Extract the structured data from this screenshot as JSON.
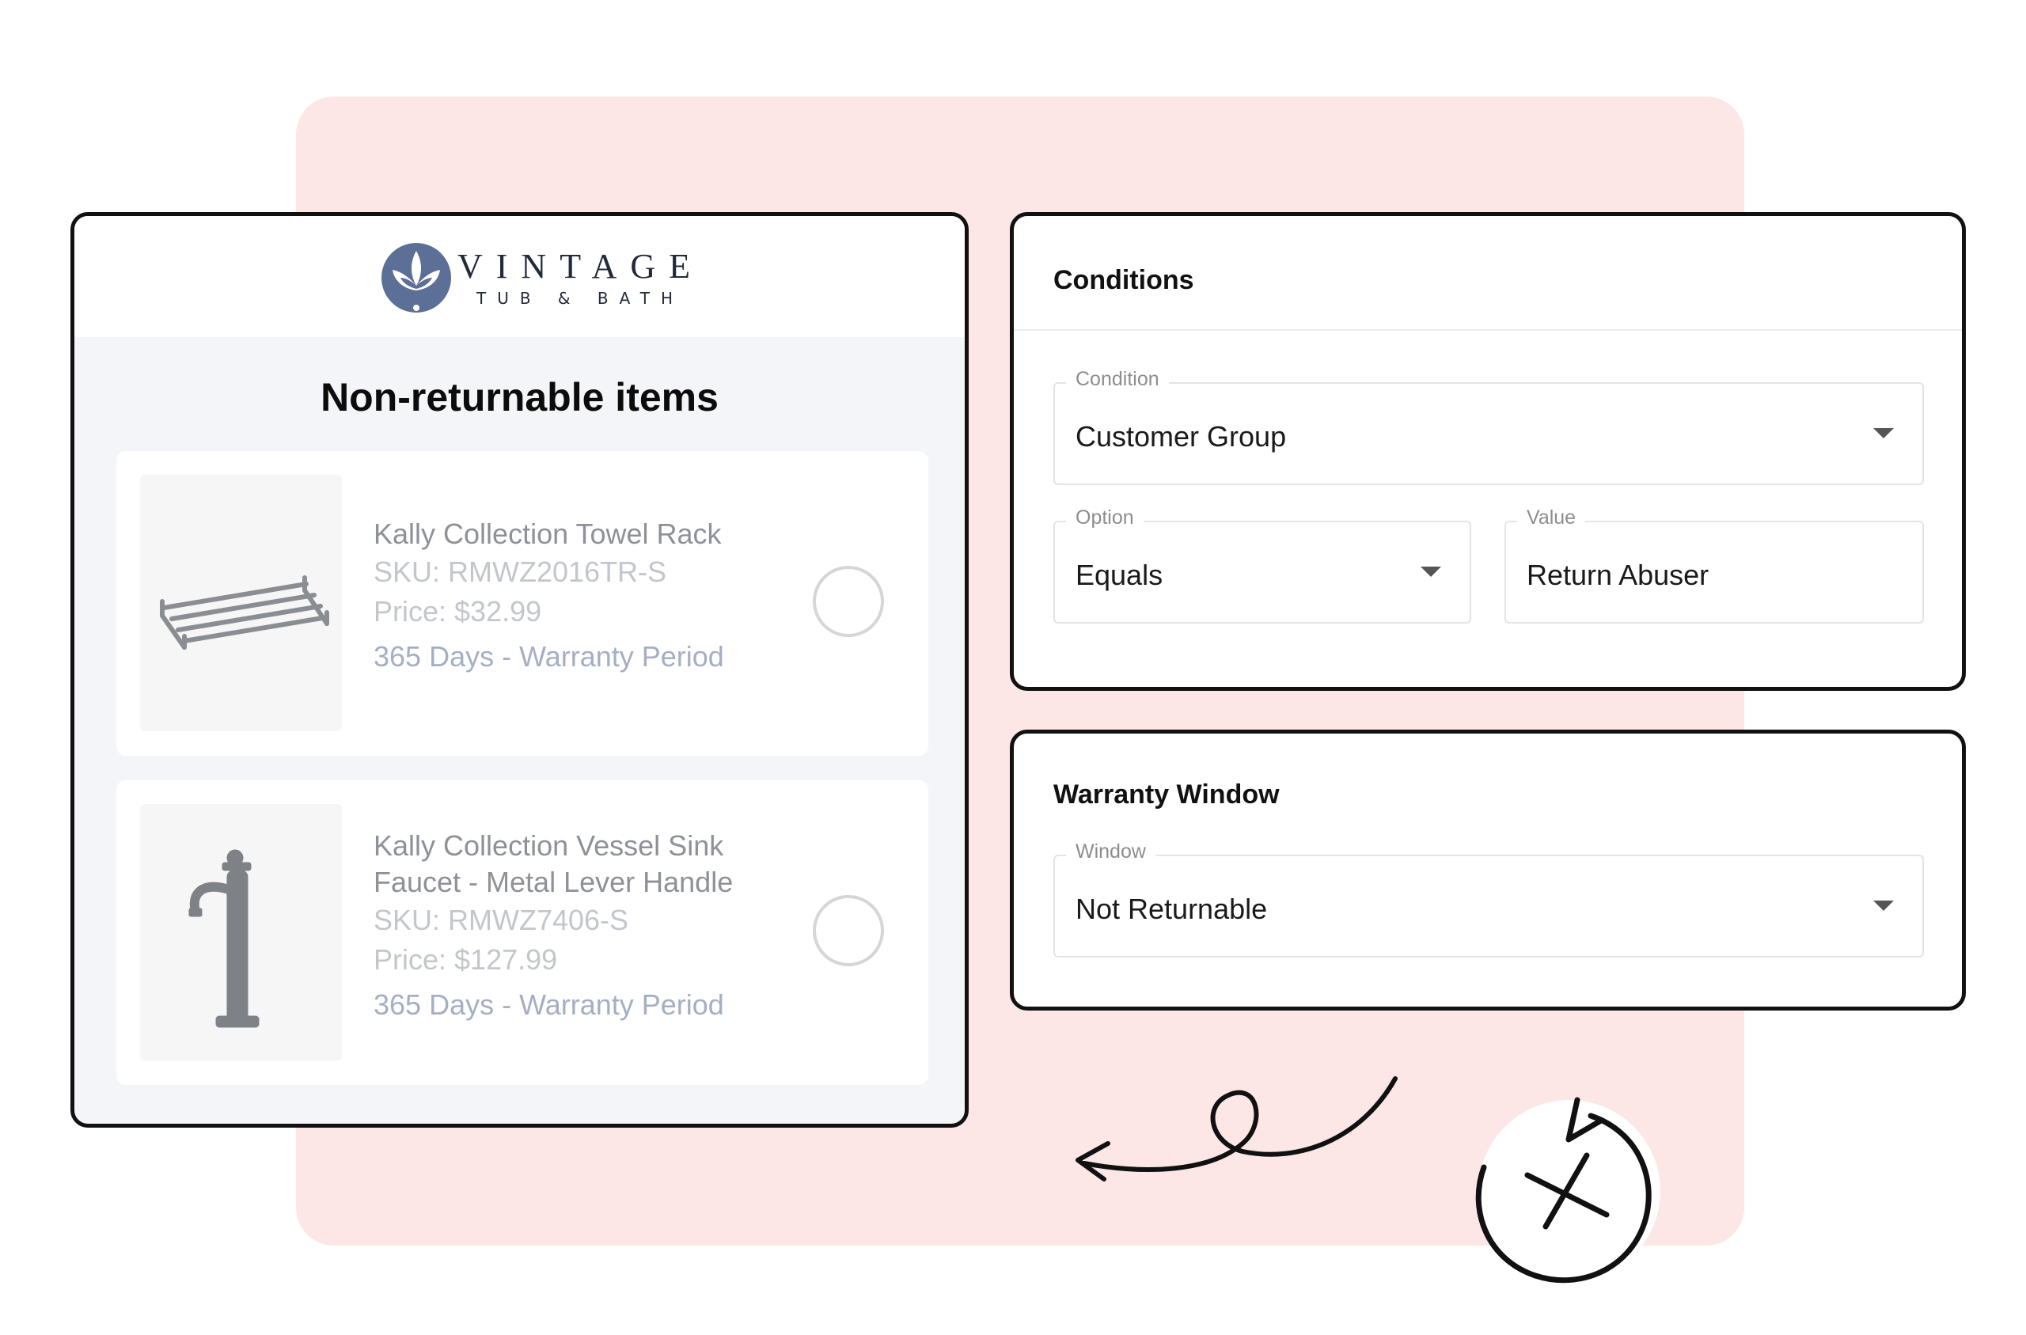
{
  "brand": {
    "name": "VINTAGE",
    "subname": "TUB & BATH",
    "color": "#5b6f97"
  },
  "returns_panel": {
    "title": "Non-returnable items",
    "items": [
      {
        "name": "Kally Collection Towel Rack",
        "sku": "SKU: RMWZ2016TR-S",
        "price": "Price: $32.99",
        "warranty": "365 Days - Warranty Period"
      },
      {
        "name": "Kally Collection Vessel Sink Faucet - Metal Lever Handle",
        "sku": "SKU: RMWZ7406-S",
        "price": "Price: $127.99",
        "warranty": "365 Days - Warranty Period"
      }
    ]
  },
  "conditions": {
    "title": "Conditions",
    "condition": {
      "label": "Condition",
      "value": "Customer Group"
    },
    "option": {
      "label": "Option",
      "value": "Equals"
    },
    "value": {
      "label": "Value",
      "value": "Return Abuser"
    }
  },
  "warranty_window": {
    "title": "Warranty Window",
    "window": {
      "label": "Window",
      "value": "Not Returnable"
    }
  },
  "colors": {
    "background_panel": "#fde6e6",
    "card_border": "#111111",
    "muted_text": "#a9acb3"
  },
  "icons": [
    "lotus-logo-icon",
    "towel-rack-image",
    "faucet-image",
    "chevron-down-icon",
    "curly-arrow-icon",
    "no-return-icon"
  ]
}
